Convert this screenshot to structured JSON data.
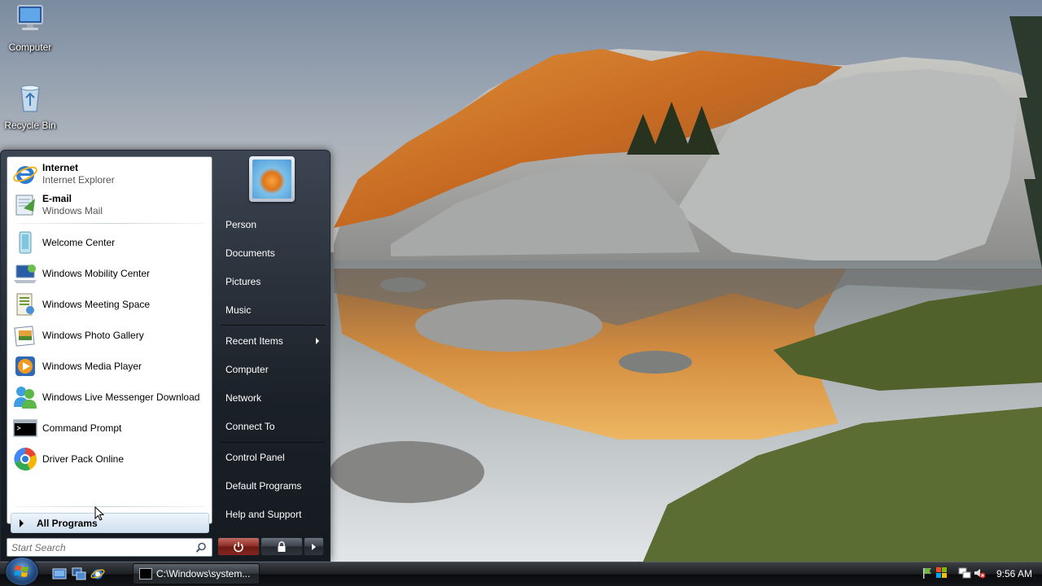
{
  "desktop": {
    "icons": [
      {
        "label": "Computer",
        "icon": "computer-icon"
      },
      {
        "label": "Recycle Bin",
        "icon": "recycle-bin-icon"
      }
    ]
  },
  "start_menu": {
    "pinned": [
      {
        "title": "Internet",
        "subtitle": "Internet Explorer",
        "icon": "internet-explorer-icon"
      },
      {
        "title": "E-mail",
        "subtitle": "Windows Mail",
        "icon": "windows-mail-icon"
      }
    ],
    "recent": [
      {
        "label": "Welcome Center",
        "icon": "welcome-center-icon"
      },
      {
        "label": "Windows Mobility Center",
        "icon": "mobility-center-icon"
      },
      {
        "label": "Windows Meeting Space",
        "icon": "meeting-space-icon"
      },
      {
        "label": "Windows Photo Gallery",
        "icon": "photo-gallery-icon"
      },
      {
        "label": "Windows Media Player",
        "icon": "media-player-icon"
      },
      {
        "label": "Windows Live Messenger Download",
        "icon": "messenger-icon"
      },
      {
        "label": "Command Prompt",
        "icon": "command-prompt-icon"
      },
      {
        "label": "Driver Pack Online",
        "icon": "driver-pack-icon"
      }
    ],
    "all_programs": "All Programs",
    "search_placeholder": "Start Search",
    "right_links": [
      {
        "label": "Person"
      },
      {
        "label": "Documents"
      },
      {
        "label": "Pictures"
      },
      {
        "label": "Music"
      },
      {
        "label": "Recent Items",
        "submenu": true
      },
      {
        "label": "Computer"
      },
      {
        "label": "Network"
      },
      {
        "label": "Connect To"
      },
      {
        "label": "Control Panel"
      },
      {
        "label": "Default Programs"
      },
      {
        "label": "Help and Support"
      }
    ]
  },
  "taskbar": {
    "task_button": "C:\\Windows\\system...",
    "clock": "9:56 AM",
    "quick_launch": [
      "show-desktop-icon",
      "switch-windows-icon",
      "internet-explorer-icon"
    ]
  }
}
